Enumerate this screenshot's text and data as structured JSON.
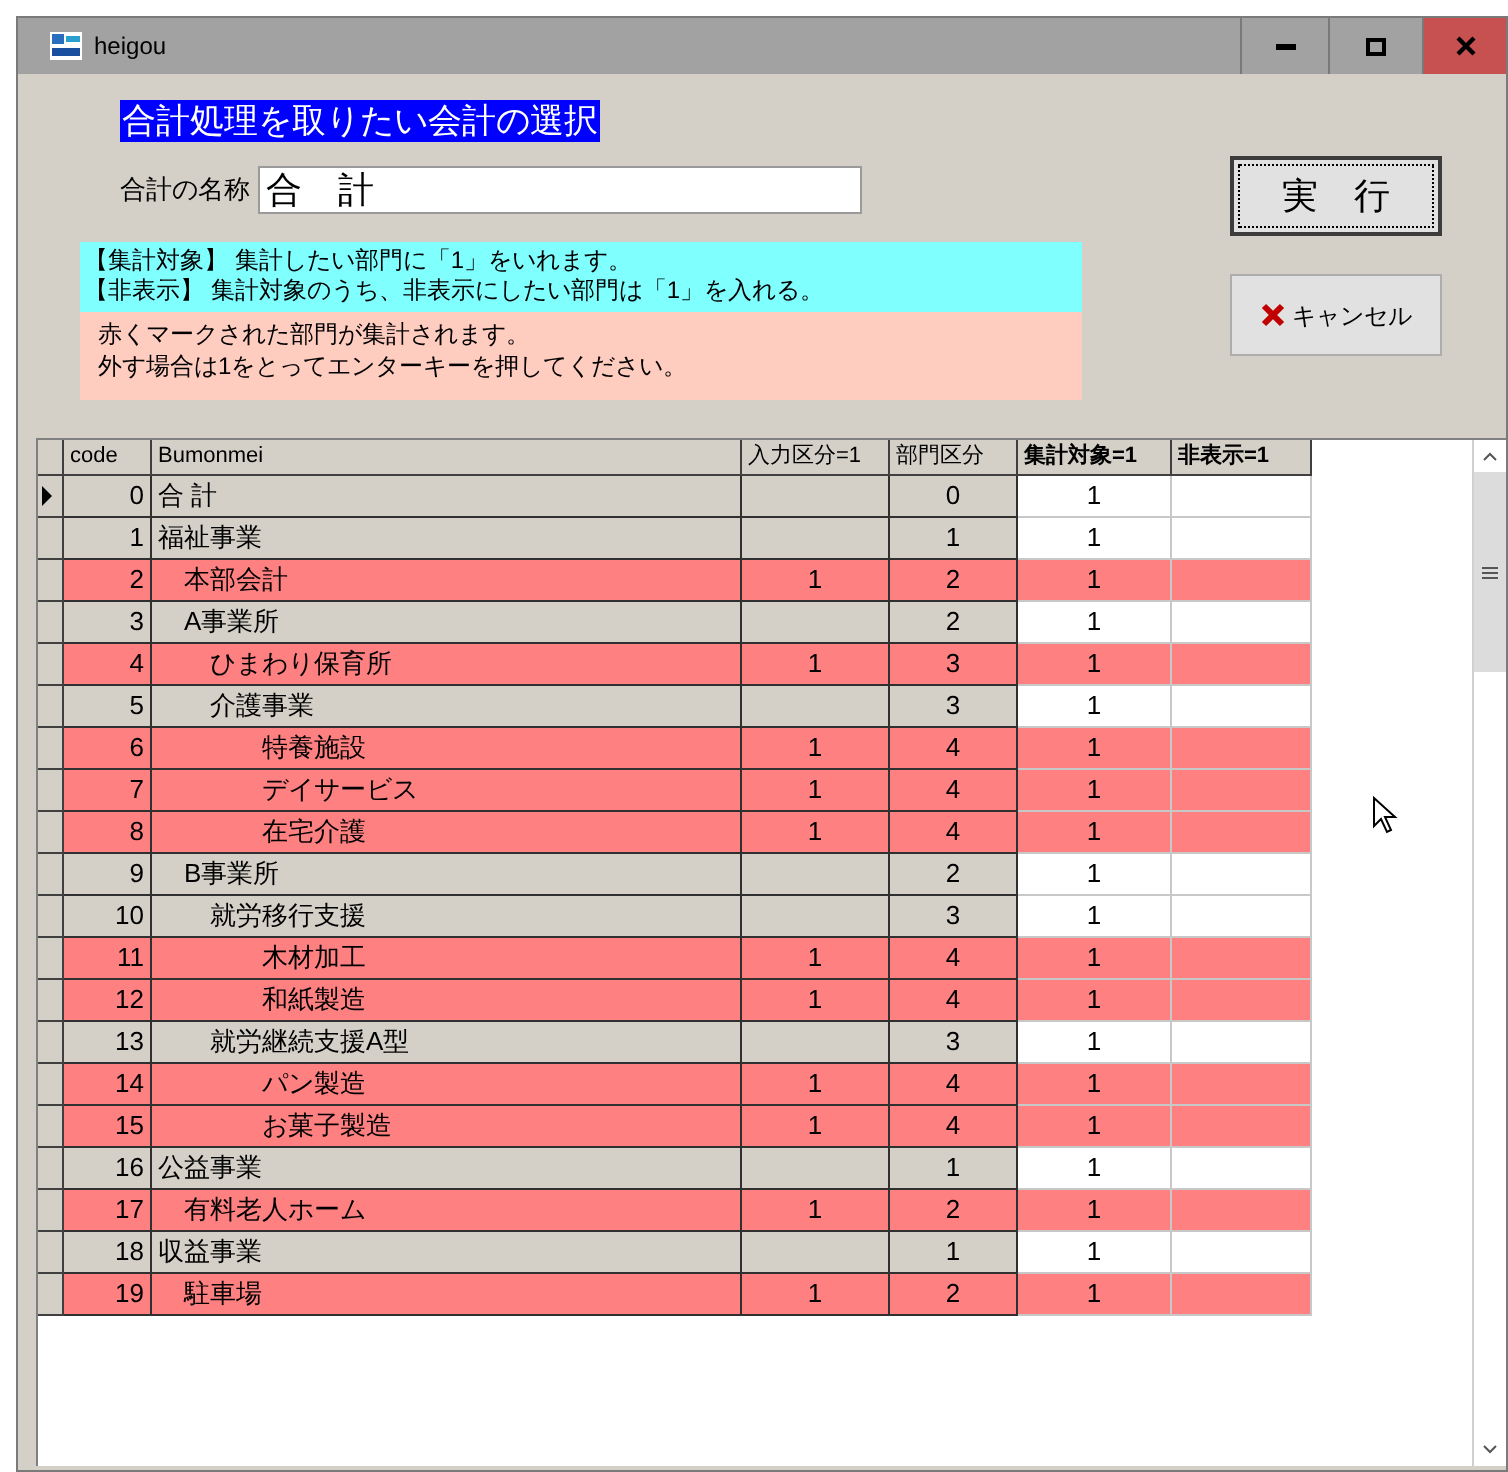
{
  "window": {
    "title": "heigou"
  },
  "heading": "合計処理を取りたい会計の選択",
  "name_field": {
    "label": "合計の名称",
    "value": "合　計"
  },
  "info_cyan": [
    "【集計対象】 集計したい部門に「1」をいれます。",
    "【非表示】 集計対象のうち、非表示にしたい部門は「1」を入れる。"
  ],
  "info_pink": [
    "赤くマークされた部門が集計されます。",
    "外す場合は1をとってエンターキーを押してください。"
  ],
  "buttons": [
    {
      "kind": "run",
      "label": "実　行"
    },
    {
      "kind": "cancel",
      "label": "キャンセル"
    }
  ],
  "table": {
    "columns": [
      {
        "label": "code",
        "bold": false
      },
      {
        "label": "Bumonmei",
        "bold": false
      },
      {
        "label": "入力区分=1",
        "bold": false
      },
      {
        "label": "部門区分",
        "bold": false
      },
      {
        "label": "集計対象=1",
        "bold": true
      },
      {
        "label": "非表示=1",
        "bold": true
      }
    ],
    "rows": [
      {
        "selected": true,
        "marked": false,
        "code": "0",
        "name": "合 計",
        "kubun": "0",
        "shukei": "1"
      },
      {
        "selected": false,
        "marked": false,
        "code": "1",
        "name": "福祉事業",
        "kubun": "1",
        "shukei": "1"
      },
      {
        "selected": false,
        "marked": true,
        "code": "2",
        "name": "　本部会計",
        "input": "1",
        "kubun": "2",
        "shukei": "1"
      },
      {
        "selected": false,
        "marked": false,
        "code": "3",
        "name": "　A事業所",
        "kubun": "2",
        "shukei": "1"
      },
      {
        "selected": false,
        "marked": true,
        "code": "4",
        "name": "　　ひまわり保育所",
        "input": "1",
        "kubun": "3",
        "shukei": "1"
      },
      {
        "selected": false,
        "marked": false,
        "code": "5",
        "name": "　　介護事業",
        "kubun": "3",
        "shukei": "1"
      },
      {
        "selected": false,
        "marked": true,
        "code": "6",
        "name": "　　　　特養施設",
        "input": "1",
        "kubun": "4",
        "shukei": "1"
      },
      {
        "selected": false,
        "marked": true,
        "code": "7",
        "name": "　　　　デイサービス",
        "input": "1",
        "kubun": "4",
        "shukei": "1"
      },
      {
        "selected": false,
        "marked": true,
        "code": "8",
        "name": "　　　　在宅介護",
        "input": "1",
        "kubun": "4",
        "shukei": "1"
      },
      {
        "selected": false,
        "marked": false,
        "code": "9",
        "name": "　B事業所",
        "kubun": "2",
        "shukei": "1"
      },
      {
        "selected": false,
        "marked": false,
        "code": "10",
        "name": "　　就労移行支援",
        "kubun": "3",
        "shukei": "1"
      },
      {
        "selected": false,
        "marked": true,
        "code": "11",
        "name": "　　　　木材加工",
        "input": "1",
        "kubun": "4",
        "shukei": "1"
      },
      {
        "selected": false,
        "marked": true,
        "code": "12",
        "name": "　　　　和紙製造",
        "input": "1",
        "kubun": "4",
        "shukei": "1"
      },
      {
        "selected": false,
        "marked": false,
        "code": "13",
        "name": "　　就労継続支援A型",
        "kubun": "3",
        "shukei": "1"
      },
      {
        "selected": false,
        "marked": true,
        "code": "14",
        "name": "　　　　パン製造",
        "input": "1",
        "kubun": "4",
        "shukei": "1"
      },
      {
        "selected": false,
        "marked": true,
        "code": "15",
        "name": "　　　　お菓子製造",
        "input": "1",
        "kubun": "4",
        "shukei": "1"
      },
      {
        "selected": false,
        "marked": false,
        "code": "16",
        "name": "公益事業",
        "kubun": "1",
        "shukei": "1"
      },
      {
        "selected": false,
        "marked": true,
        "code": "17",
        "name": "　有料老人ホーム",
        "input": "1",
        "kubun": "2",
        "shukei": "1"
      },
      {
        "selected": false,
        "marked": false,
        "code": "18",
        "name": "収益事業",
        "kubun": "1",
        "shukei": "1"
      },
      {
        "selected": false,
        "marked": true,
        "code": "19",
        "name": "　駐車場",
        "input": "1",
        "kubun": "2",
        "shukei": "1"
      }
    ]
  }
}
